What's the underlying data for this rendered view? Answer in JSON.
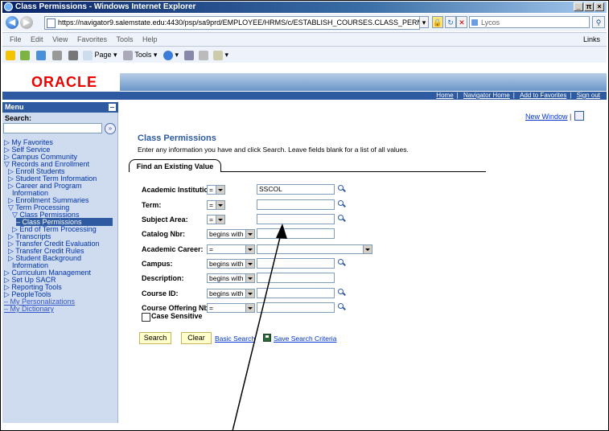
{
  "window": {
    "title": "Class Permissions - Windows Internet Explorer",
    "btn_min": "_",
    "btn_max": "π",
    "btn_close": "×"
  },
  "browser": {
    "address": "https://navigator9.salemstate.edu:4430/psp/sa9prd/EMPLOYEE/HRMS/c/ESTABLISH_COURSES.CLASS_PERMISSION.GBL",
    "search_engine": "Lycos",
    "menu": [
      "File",
      "Edit",
      "View",
      "Favorites",
      "Tools",
      "Help"
    ],
    "links_label": "Links",
    "toolbar": {
      "page": "Page",
      "tools": "Tools"
    }
  },
  "header": {
    "logo": "ORACLE",
    "links": [
      "Home",
      "Navigator Home",
      "Add to Favorites",
      "Sign out"
    ],
    "separator": "|"
  },
  "sidebar": {
    "title": "Menu",
    "search_label": "Search:",
    "go_symbol": "»",
    "items": [
      {
        "label": "▷ My Favorites"
      },
      {
        "label": "▷ Self Service"
      },
      {
        "label": "▷ Campus Community"
      },
      {
        "label": "▽ Records and Enrollment"
      },
      {
        "label": "▷ Enroll Students"
      },
      {
        "label": "▷ Student Term Information"
      },
      {
        "label": "▷ Career and Program"
      },
      {
        "label": "Information"
      },
      {
        "label": "▷ Enrollment Summaries"
      },
      {
        "label": "▽ Term Processing"
      },
      {
        "label": "▽ Class Permissions"
      },
      {
        "label": "– Class Permissions"
      },
      {
        "label": "▷ End of Term Processing"
      },
      {
        "label": "▷ Transcripts"
      },
      {
        "label": "▷ Transfer Credit Evaluation"
      },
      {
        "label": "▷ Transfer Credit Rules"
      },
      {
        "label": "▷ Student Background"
      },
      {
        "label": "Information"
      },
      {
        "label": "▷ Curriculum Management"
      },
      {
        "label": "▷ Set Up SACR"
      },
      {
        "label": "▷ Reporting Tools"
      },
      {
        "label": "▷ PeopleTools"
      },
      {
        "label": "– My Personalizations"
      },
      {
        "label": "– My Dictionary"
      }
    ]
  },
  "main": {
    "new_window": "New Window",
    "new_window_sep": "|",
    "help_icon_text": "Help",
    "title": "Class Permissions",
    "instructions": "Enter any information you have and click Search. Leave fields blank for a list of all values.",
    "tab": "Find an Existing Value",
    "fields": [
      {
        "label": "Academic Institution:",
        "operator": "=",
        "value": "SSCOL"
      },
      {
        "label": "Term:",
        "operator": "=",
        "value": ""
      },
      {
        "label": "Subject Area:",
        "operator": "=",
        "value": ""
      },
      {
        "label": "Catalog Nbr:",
        "operator": "begins with",
        "value": ""
      },
      {
        "label": "Academic Career:",
        "operator": "=",
        "value": ""
      },
      {
        "label": "Campus:",
        "operator": "begins with",
        "value": ""
      },
      {
        "label": "Description:",
        "operator": "begins with",
        "value": ""
      },
      {
        "label": "Course ID:",
        "operator": "begins with",
        "value": ""
      },
      {
        "label": "Course Offering Nbr:",
        "operator": "=",
        "value": ""
      }
    ],
    "case_sensitive": "Case Sensitive",
    "search_button": "Search",
    "clear_button": "Clear",
    "basic_search": "Basic Search",
    "save_criteria": "Save Search Criteria"
  },
  "colors": {
    "accent": "#2d5aa0",
    "logo": "#e00000",
    "button": "#ffffcc"
  }
}
